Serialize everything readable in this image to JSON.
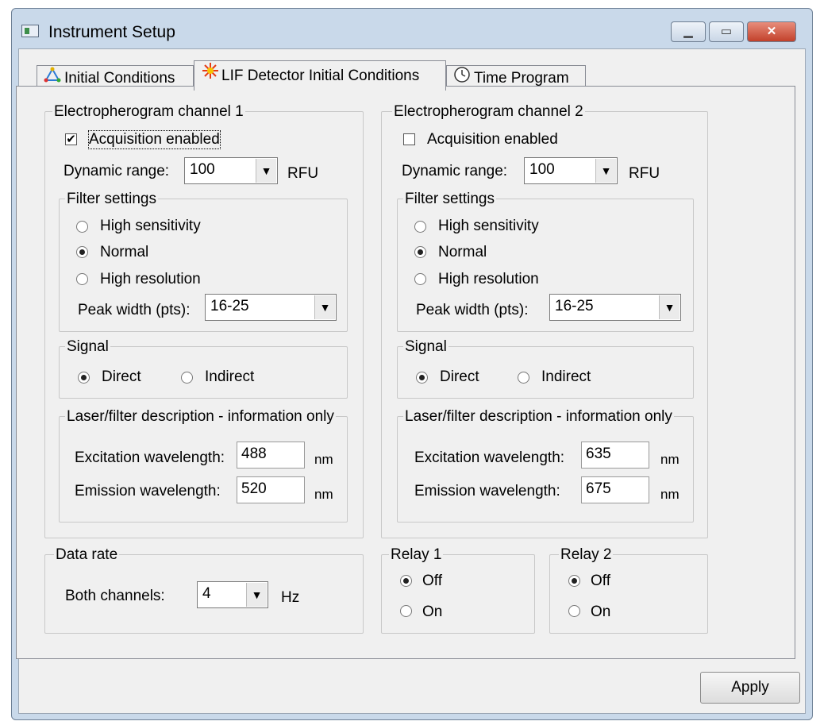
{
  "window": {
    "title": "Instrument Setup",
    "buttons": {
      "minimize": "▁",
      "maximize": "▭",
      "close": "✕"
    }
  },
  "tabs": [
    {
      "label": "Initial Conditions",
      "icon": "initial-conditions-icon"
    },
    {
      "label": "LIF Detector Initial Conditions",
      "icon": "laser-icon"
    },
    {
      "label": "Time Program",
      "icon": "clock-icon"
    }
  ],
  "channel1": {
    "title": "Electropherogram channel 1",
    "acquisition_label": "Acquisition enabled",
    "acquisition_checked": true,
    "dynamic_range_label": "Dynamic range:",
    "dynamic_range_value": "100",
    "dynamic_range_unit": "RFU",
    "filter_title": "Filter settings",
    "filter_options": [
      "High sensitivity",
      "Normal",
      "High resolution"
    ],
    "filter_selected": "Normal",
    "peak_width_label": "Peak width (pts):",
    "peak_width_value": "16-25",
    "signal_title": "Signal",
    "signal_options": [
      "Direct",
      "Indirect"
    ],
    "signal_selected": "Direct",
    "laser_title": "Laser/filter description - information only",
    "excitation_label": "Excitation wavelength:",
    "excitation_value": "488",
    "emission_label": "Emission wavelength:",
    "emission_value": "520",
    "unit": "nm"
  },
  "channel2": {
    "title": "Electropherogram channel 2",
    "acquisition_label": "Acquisition enabled",
    "acquisition_checked": false,
    "dynamic_range_label": "Dynamic range:",
    "dynamic_range_value": "100",
    "dynamic_range_unit": "RFU",
    "filter_title": "Filter settings",
    "filter_options": [
      "High sensitivity",
      "Normal",
      "High resolution"
    ],
    "filter_selected": "Normal",
    "peak_width_label": "Peak width (pts):",
    "peak_width_value": "16-25",
    "signal_title": "Signal",
    "signal_options": [
      "Direct",
      "Indirect"
    ],
    "signal_selected": "Direct",
    "laser_title": "Laser/filter description - information only",
    "excitation_label": "Excitation wavelength:",
    "excitation_value": "635",
    "emission_label": "Emission wavelength:",
    "emission_value": "675",
    "unit": "nm"
  },
  "data_rate": {
    "title": "Data rate",
    "label": "Both channels:",
    "value": "4",
    "unit": "Hz"
  },
  "relay1": {
    "title": "Relay 1",
    "options": [
      "Off",
      "On"
    ],
    "selected": "Off"
  },
  "relay2": {
    "title": "Relay 2",
    "options": [
      "Off",
      "On"
    ],
    "selected": "Off"
  },
  "apply_label": "Apply"
}
